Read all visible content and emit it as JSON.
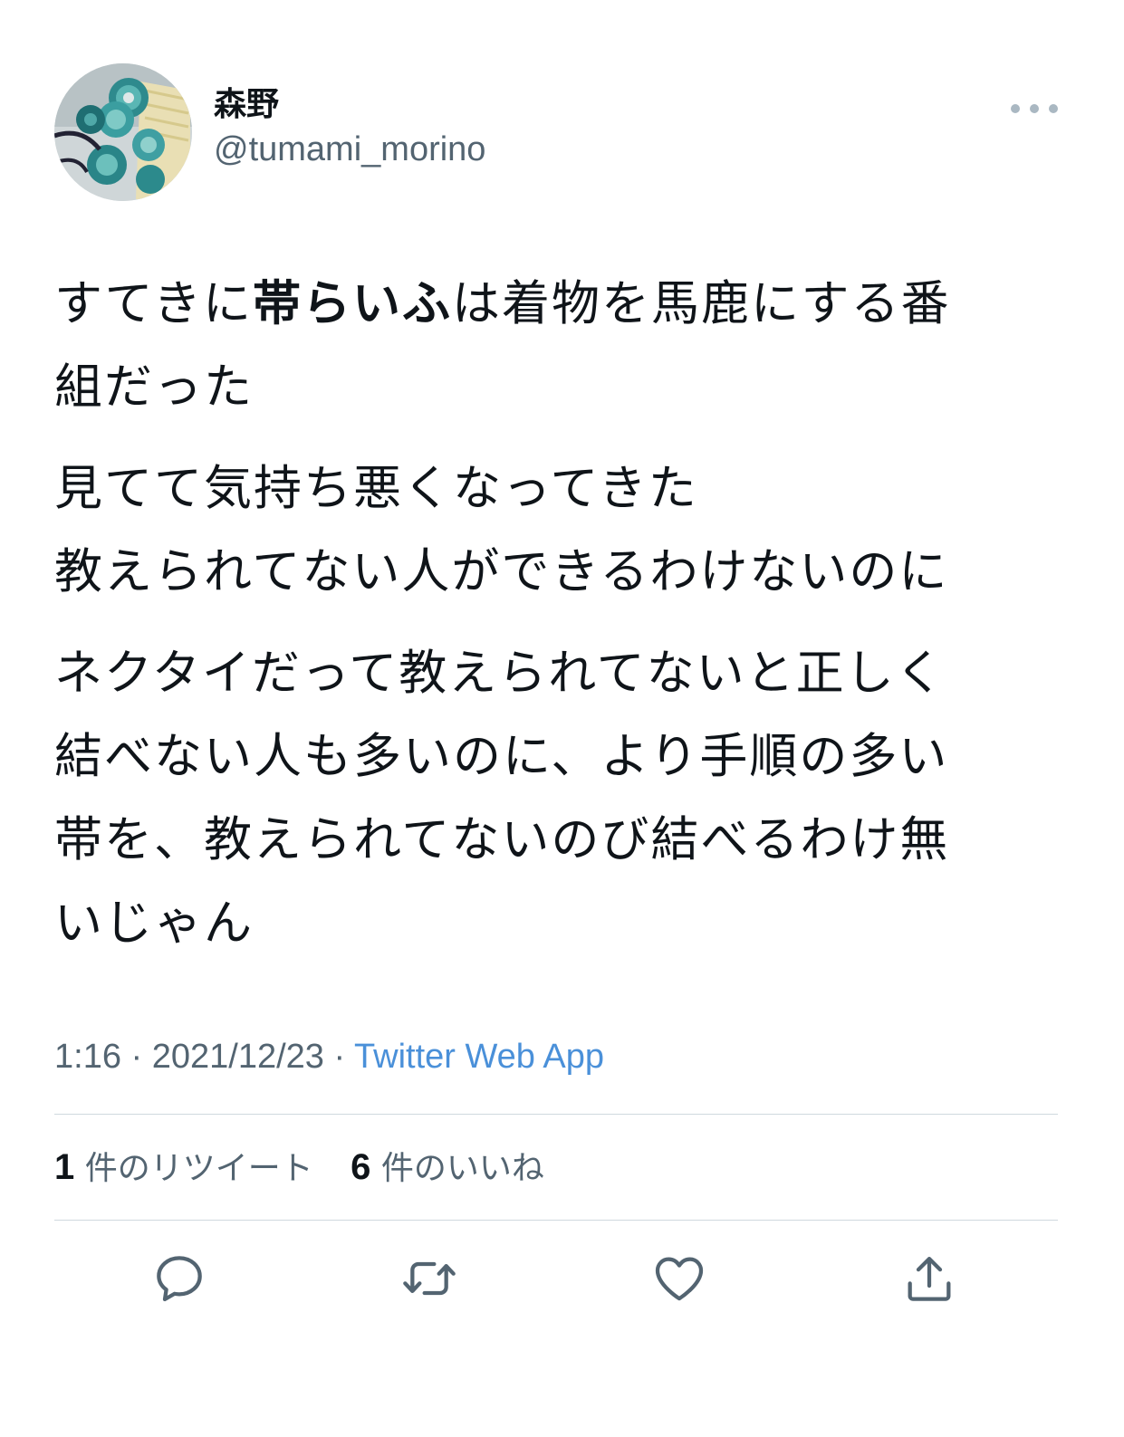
{
  "user": {
    "display_name": "森野",
    "handle": "@tumami_morino"
  },
  "tweet": {
    "paragraphs": [
      {
        "lines": [
          [
            {
              "text": "すてきに",
              "bold": false
            },
            {
              "text": "帯らいふ",
              "bold": true
            },
            {
              "text": "は着物を馬鹿にする番",
              "bold": false
            }
          ],
          [
            {
              "text": "組だった",
              "bold": false
            }
          ]
        ]
      },
      {
        "lines": [
          [
            {
              "text": "見てて気持ち悪くなってきた",
              "bold": false
            }
          ],
          [
            {
              "text": "教えられてない人ができるわけないのに",
              "bold": false
            }
          ]
        ]
      },
      {
        "lines": [
          [
            {
              "text": "ネクタイだって教えられてないと正しく",
              "bold": false
            }
          ],
          [
            {
              "text": "結べない人も多いのに、より手順の多い",
              "bold": false
            }
          ],
          [
            {
              "text": "帯を、教えられてないのび結べるわけ無",
              "bold": false
            }
          ],
          [
            {
              "text": "いじゃん",
              "bold": false
            }
          ]
        ]
      }
    ],
    "time": "1:16",
    "separator": " · ",
    "date": "2021/12/23",
    "source": "Twitter Web App"
  },
  "stats": {
    "retweets_count": "1",
    "retweets_label": "件のリツイート",
    "likes_count": "6",
    "likes_label": "件のいいね"
  },
  "icons": {
    "more": "more-icon",
    "reply": "reply-icon",
    "retweet": "retweet-icon",
    "like": "heart-icon",
    "share": "share-icon"
  },
  "colors": {
    "text": "#0f1419",
    "secondary": "#536471",
    "link": "#4a90d9",
    "icon": "#536471",
    "divider": "#cfd9de"
  }
}
